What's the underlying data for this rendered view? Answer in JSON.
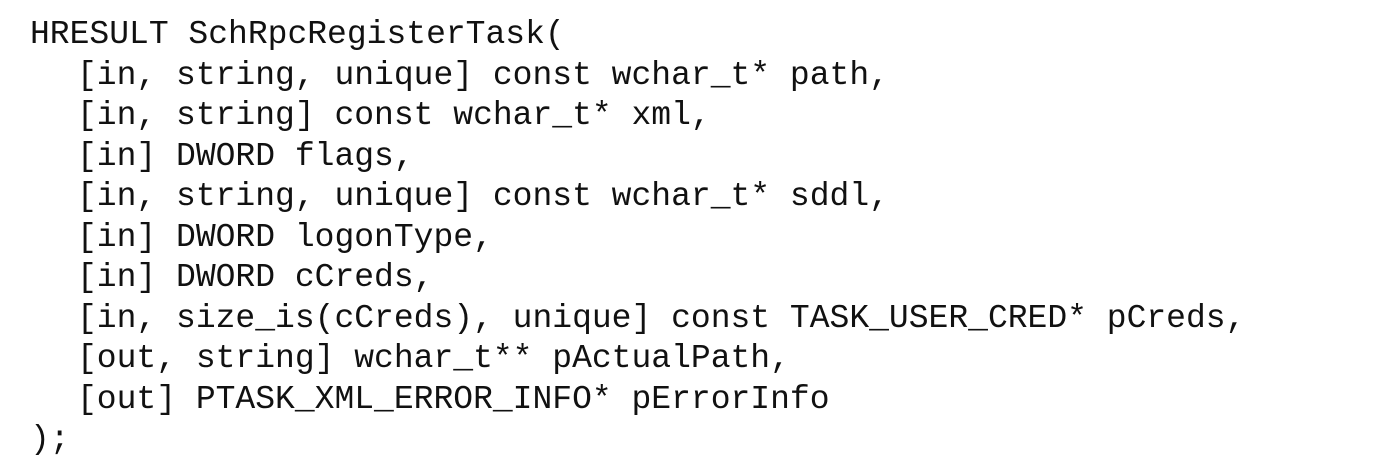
{
  "code": {
    "header": "HRESULT SchRpcRegisterTask(",
    "params": [
      "[in, string, unique] const wchar_t* path,",
      "[in, string] const wchar_t* xml,",
      "[in] DWORD flags,",
      "[in, string, unique] const wchar_t* sddl,",
      "[in] DWORD logonType,",
      "[in] DWORD cCreds,",
      "[in, size_is(cCreds), unique] const TASK_USER_CRED* pCreds,",
      "[out, string] wchar_t** pActualPath,",
      "[out] PTASK_XML_ERROR_INFO* pErrorInfo"
    ],
    "footer": ");"
  }
}
